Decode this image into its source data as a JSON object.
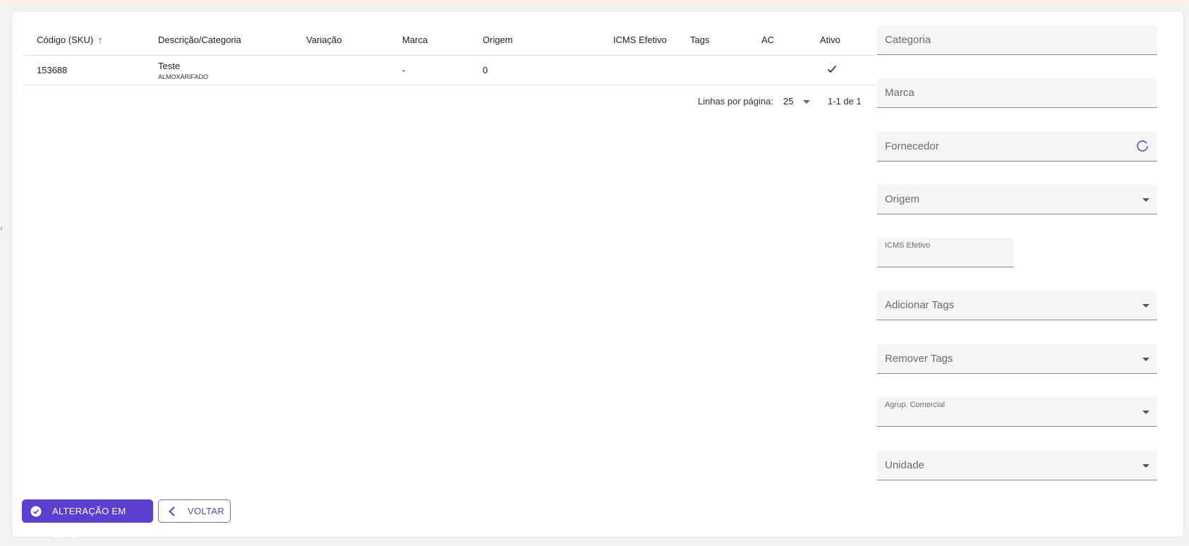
{
  "table": {
    "columns": [
      "Código (SKU)",
      "Descrição/Categoria",
      "Variação",
      "Marca",
      "Origem",
      "ICMS Efetivo",
      "Tags",
      "AC",
      "Ativo"
    ],
    "rows": [
      {
        "sku": "153688",
        "descricao": "Teste",
        "categoria": "ALMOXARIFADO",
        "variacao": "",
        "marca": "-",
        "origem": "0",
        "icms": "",
        "tags": "",
        "ac": "",
        "ativo": true
      }
    ]
  },
  "pagination": {
    "rows_label": "Linhas por página:",
    "rows_value": "25",
    "range": "1-1 de 1"
  },
  "filters": {
    "categoria": "Categoria",
    "marca": "Marca",
    "fornecedor": "Fornecedor",
    "origem": "Origem",
    "icms": "ICMS Efetivo",
    "add_tags": "Adicionar Tags",
    "remove_tags": "Remover Tags",
    "agrup": "Agrup. Comercial",
    "unidade": "Unidade"
  },
  "actions": {
    "batch_label": "ALTERAÇÃO EM LOTE",
    "back_label": "VOLTAR"
  },
  "colors": {
    "accent": "#5b3fd0"
  }
}
